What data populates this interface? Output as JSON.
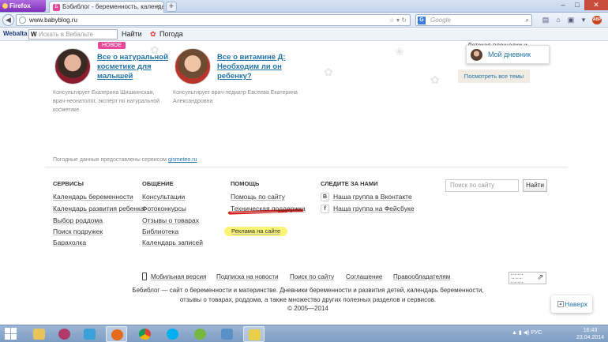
{
  "browser": {
    "menu_button": "Firefox",
    "tab_title": "Бэбиблог - беременность, календарь ...",
    "tab_favicon": "Б",
    "url": "www.babyblog.ru",
    "search_placeholder": "Google",
    "search_engine_icon": "G",
    "addon_badge": "ABP"
  },
  "bookmarks": {
    "logo": "Webalta",
    "search_letter": "W",
    "search_placeholder": "Искать в Вебальте",
    "find_label": "Найти",
    "weather_label": "Погода"
  },
  "experts": [
    {
      "badge": "новое",
      "title_line1": "Все о натуральной",
      "title_line2": "косметике для",
      "title_line3": "малышей",
      "desc_line1": "Консультирует Екатерина Шишкинская,",
      "desc_line2": "врач-неонатолог, эксперт по натуральной",
      "desc_line3": "косметике."
    },
    {
      "title_line1": "Все о витамине Д:",
      "title_line2": "Необходим ли он",
      "title_line3": "ребенку?",
      "desc_line1": "Консультирует врач-педиатр Евсеева Екатерина",
      "desc_line2": "Александровна"
    }
  ],
  "sidebar": {
    "partial_title": "Детская площадки и ...",
    "my_diary": "Мой дневник",
    "all_topics": "Посмотреть все темы"
  },
  "weather_note": {
    "text": "Погодные данные предоставлены сервисом ",
    "link": "gismeteo.ru"
  },
  "footer": {
    "services": {
      "heading": "Сервисы",
      "items": [
        "Календарь беременности",
        "Календарь развития ребенка",
        "Выбор роддома",
        "Поиск подружек",
        "Барахолка"
      ]
    },
    "communication": {
      "heading": "Общение",
      "items": [
        "Консультации",
        "Фотоконкурсы",
        "Отзывы о товарах",
        "Библиотека",
        "Календарь записей"
      ]
    },
    "help": {
      "heading": "Помощь",
      "items": [
        "Помощь по сайту",
        "Техническая поддержка",
        "Реклама на сайте"
      ]
    },
    "follow": {
      "heading": "Следите за нами",
      "items": [
        {
          "icon": "В",
          "label": "Наша группа в Вконтакте"
        },
        {
          "icon": "f",
          "label": "Наша группа на Фейсбуке"
        }
      ]
    },
    "site_search_placeholder": "Поиск по сайту",
    "find_button": "Найти",
    "bottom_links": [
      "Мобильная версия",
      "Подписка на новости",
      "Поиск по сайту",
      "Соглашение",
      "Правообладателям"
    ],
    "description_line1": "Бебиблог — сайт о беременности и материнстве. Дневники беременности и развития детей, календарь беременности,",
    "description_line2": "отзывы о товарах, роддома, а также множество других полезных разделов и сервисов.",
    "copyright": "© 2005—2014"
  },
  "back_to_top": "Наверх",
  "taskbar": {
    "tray_lang": "РУС",
    "clock_time": "16:43",
    "clock_date": "23.04.2014"
  },
  "colors": {
    "link": "#2374a8",
    "badge": "#e8489a",
    "annotation_underline": "#e0201a",
    "annotation_highlight": "#fbf25c"
  }
}
